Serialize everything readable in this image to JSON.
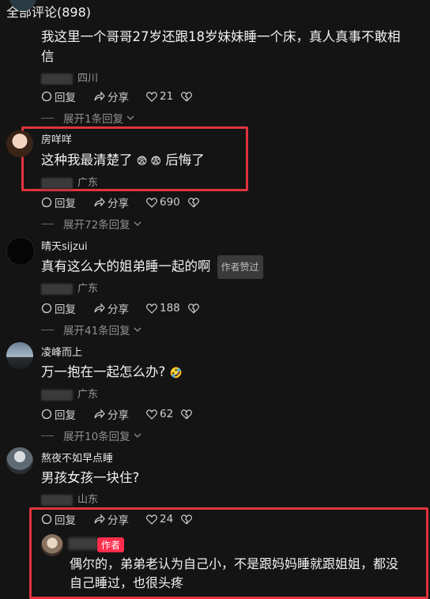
{
  "header": {
    "title": "全部评论(898)"
  },
  "comments": [
    {
      "text_line1": "我这里一个哥哥27岁还跟18岁妹妹睡一个床，真人真事不敢相",
      "text_line2": "信",
      "location": "四川",
      "reply": "回复",
      "share": "分享",
      "likes": "21",
      "expand": "展开1条回复"
    },
    {
      "username": "房咩咩",
      "text_a": "这种我最清楚了",
      "emoji": "😨 😨",
      "text_b": "后悔了",
      "location": "广东",
      "reply": "回复",
      "share": "分享",
      "likes": "690",
      "expand": "展开72条回复"
    },
    {
      "username": "晴天sijzui",
      "text": "真有这么大的姐弟睡一起的啊",
      "tag": "作者赞过",
      "location": "广东",
      "reply": "回复",
      "share": "分享",
      "likes": "188",
      "expand": "展开41条回复"
    },
    {
      "username": "凌峰而上",
      "text": "万一抱在一起怎么办?",
      "emoji": "🤣",
      "location": "广东",
      "reply": "回复",
      "share": "分享",
      "likes": "62",
      "expand": "展开10条回复"
    },
    {
      "username": "熬夜不如早点睡",
      "text": "男孩女孩一块住?",
      "location": "山东",
      "reply": "回复",
      "share": "分享",
      "likes": "24"
    }
  ],
  "author_reply": {
    "tag": "作者",
    "line1": "偶尔的，弟弟老认为自己小，不是跟妈妈睡就跟姐姐，都没",
    "line2": "自己睡过，也很头疼"
  },
  "colors": {
    "highlight": "#e0343e",
    "author_tag": "#ff2e4d",
    "background": "#141414"
  }
}
